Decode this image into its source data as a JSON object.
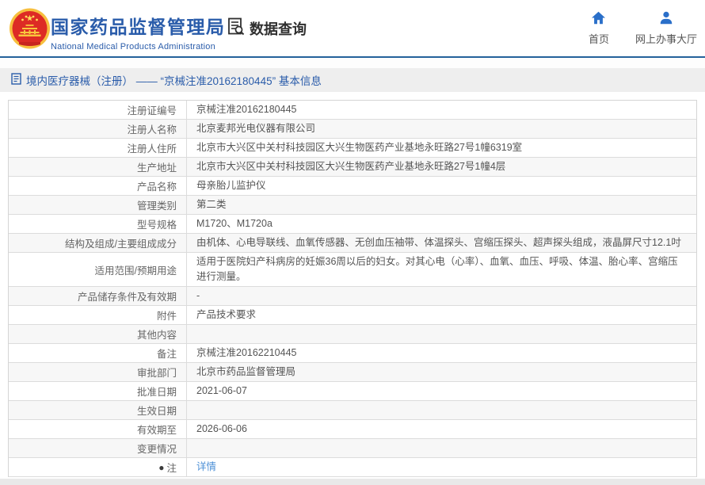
{
  "header": {
    "site_title": "国家药品监督管理局",
    "site_subtitle": "National Medical Products Administration",
    "data_query_label": "数据查询",
    "nav": [
      {
        "label": "首页",
        "icon": "home-icon"
      },
      {
        "label": "网上办事大厅",
        "icon": "user-icon"
      }
    ]
  },
  "breadcrumb": {
    "text": "境内医疗器械（注册） —— “京械注准20162180445” 基本信息",
    "icon": "document-icon"
  },
  "table": {
    "rows": [
      {
        "label": "注册证编号",
        "value": "京械注准20162180445"
      },
      {
        "label": "注册人名称",
        "value": "北京麦邦光电仪器有限公司"
      },
      {
        "label": "注册人住所",
        "value": "北京市大兴区中关村科技园区大兴生物医药产业基地永旺路27号1幢6319室"
      },
      {
        "label": "生产地址",
        "value": "北京市大兴区中关村科技园区大兴生物医药产业基地永旺路27号1幢4层"
      },
      {
        "label": "产品名称",
        "value": "母亲胎儿监护仪"
      },
      {
        "label": "管理类别",
        "value": "第二类"
      },
      {
        "label": "型号规格",
        "value": "M1720、M1720a"
      },
      {
        "label": "结构及组成/主要组成成分",
        "value": "由机体、心电导联线、血氧传感器、无创血压袖带、体温探头、宫缩压探头、超声探头组成，液晶屏尺寸12.1吋"
      },
      {
        "label": "适用范围/预期用途",
        "value": "适用于医院妇产科病房的妊娠36周以后的妇女。对其心电（心率）、血氧、血压、呼吸、体温、胎心率、宫缩压进行测量。"
      },
      {
        "label": "产品储存条件及有效期",
        "value": "-"
      },
      {
        "label": "附件",
        "value": "产品技术要求"
      },
      {
        "label": "其他内容",
        "value": ""
      },
      {
        "label": "备注",
        "value": "京械注准20162210445"
      },
      {
        "label": "审批部门",
        "value": "北京市药品监督管理局"
      },
      {
        "label": "批准日期",
        "value": "2021-06-07"
      },
      {
        "label": "生效日期",
        "value": ""
      },
      {
        "label": "有效期至",
        "value": "2026-06-06"
      },
      {
        "label": "变更情况",
        "value": ""
      },
      {
        "label": "注",
        "value": "详情",
        "icon": "note-icon",
        "is_link": true
      }
    ]
  },
  "colors": {
    "brand_blue": "#2a5caa",
    "header_rule": "#25629b",
    "breadcrumb_bg": "#eeeeee",
    "row_stripe": "#f7f7f7",
    "border": "#dcdcdc",
    "link_blue": "#4c8fd6",
    "icon_blue": "#2a6fc9",
    "emblem_red": "#dd2b25",
    "emblem_gold": "#f7bf3e"
  }
}
